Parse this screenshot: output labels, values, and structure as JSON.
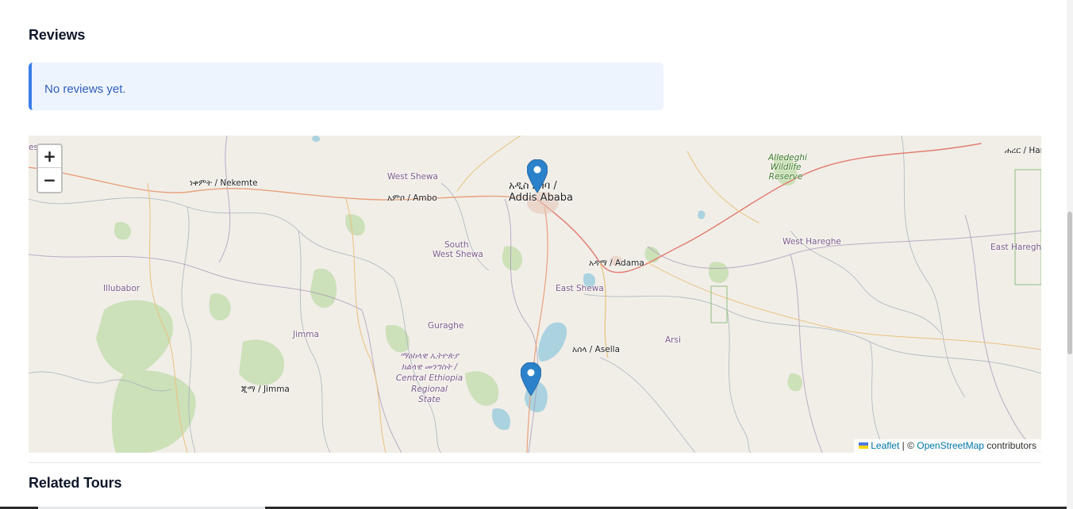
{
  "reviews": {
    "title": "Reviews",
    "empty_message": "No reviews yet."
  },
  "map": {
    "zoom_in": "+",
    "zoom_out": "−",
    "attribution": {
      "leaflet": "Leaflet",
      "separator": " | © ",
      "osm": "OpenStreetMap",
      "contributors": " contributors"
    },
    "labels": {
      "nekemte": "ነቀምት / Nekemte",
      "ambo": "አምቦ / Ambo",
      "west_shewa": "West Shewa",
      "addis_am": "አዲስ አበባ /",
      "addis_en": "Addis Ababa",
      "adama": "አዳማ / Adama",
      "east_shewa": "East Shewa",
      "south_west_shewa_1": "South",
      "south_west_shewa_2": "West Shewa",
      "illubabor": "Illubabor",
      "jimma_zone": "Jimma",
      "jimma_city": "ጂማ / Jimma",
      "guraghe": "Guraghe",
      "asella": "አሰላ / Asella",
      "arsi": "Arsi",
      "west_hareghe": "West Hareghe",
      "east_hareghe": "East Hareghe",
      "harar": "ሐረር / Har",
      "alledeghi_1": "Alledeghi",
      "alledeghi_2": "Wildlife",
      "alledeghi_3": "Reserve",
      "central_1": "ማዕከላዊ ኢትዮጵያ",
      "central_2": "ክልላዊ መንግስት /",
      "central_3": "Central Ethiopia",
      "central_4": "Regional",
      "central_5": "State",
      "edge_left": "es  ga"
    },
    "markers": [
      "Addis Ababa",
      "Ziway"
    ]
  },
  "related": {
    "title": "Related Tours"
  },
  "colors": {
    "notice_bg": "#eef4fe",
    "notice_border": "#3b7de8",
    "notice_text": "#2d5fb9",
    "marker": "#2b82cb",
    "link": "#0078a8"
  }
}
